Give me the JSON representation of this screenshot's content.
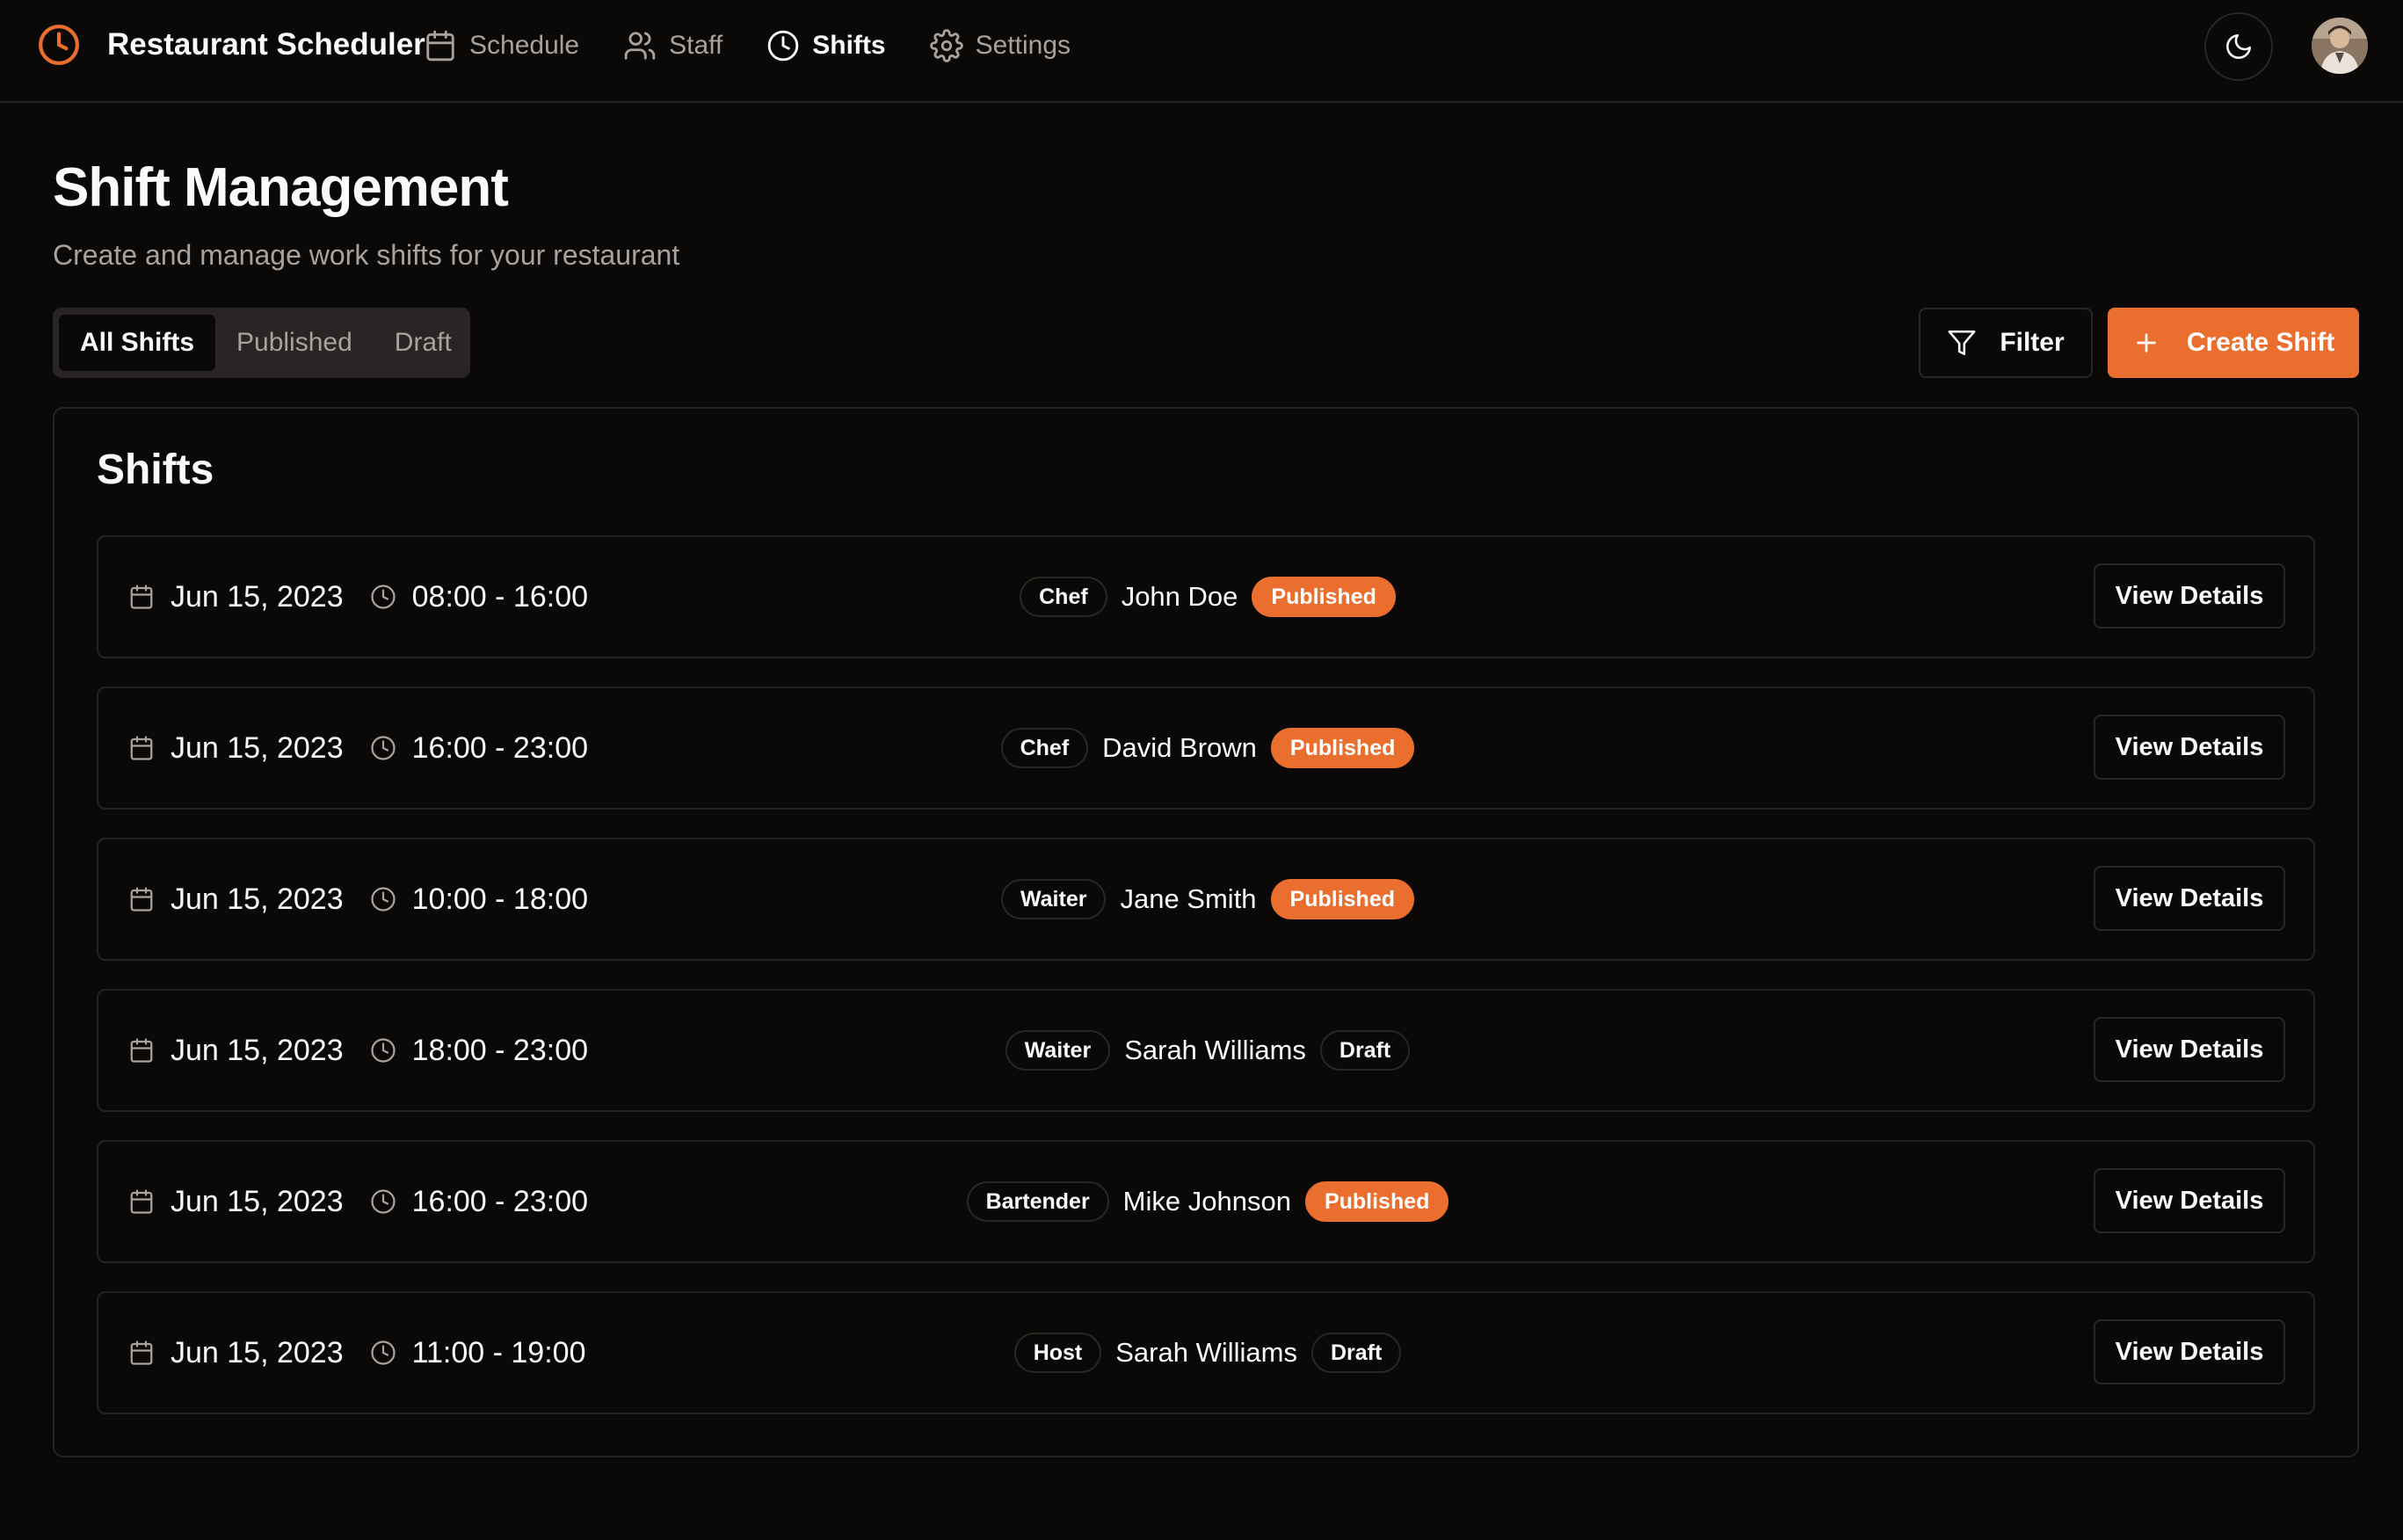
{
  "app": {
    "name": "Restaurant Scheduler",
    "accent_color": "#ea6f2e",
    "logo_icon": "clock-icon"
  },
  "nav": {
    "items": [
      {
        "label": "Schedule",
        "icon": "calendar-icon",
        "active": false
      },
      {
        "label": "Staff",
        "icon": "users-icon",
        "active": false
      },
      {
        "label": "Shifts",
        "icon": "clock-icon",
        "active": true
      },
      {
        "label": "Settings",
        "icon": "gear-icon",
        "active": false
      }
    ],
    "theme_toggle_icon": "moon-icon"
  },
  "page": {
    "title": "Shift Management",
    "subtitle": "Create and manage work shifts for your restaurant"
  },
  "tabs": [
    {
      "label": "All Shifts",
      "active": true
    },
    {
      "label": "Published",
      "active": false
    },
    {
      "label": "Draft",
      "active": false
    }
  ],
  "actions": {
    "filter_label": "Filter",
    "create_label": "Create Shift"
  },
  "shifts_card": {
    "title": "Shifts",
    "view_label": "View Details",
    "rows": [
      {
        "date": "Jun 15, 2023",
        "time": "08:00 - 16:00",
        "role": "Chef",
        "name": "John Doe",
        "status": "Published"
      },
      {
        "date": "Jun 15, 2023",
        "time": "16:00 - 23:00",
        "role": "Chef",
        "name": "David Brown",
        "status": "Published"
      },
      {
        "date": "Jun 15, 2023",
        "time": "10:00 - 18:00",
        "role": "Waiter",
        "name": "Jane Smith",
        "status": "Published"
      },
      {
        "date": "Jun 15, 2023",
        "time": "18:00 - 23:00",
        "role": "Waiter",
        "name": "Sarah Williams",
        "status": "Draft"
      },
      {
        "date": "Jun 15, 2023",
        "time": "16:00 - 23:00",
        "role": "Bartender",
        "name": "Mike Johnson",
        "status": "Published"
      },
      {
        "date": "Jun 15, 2023",
        "time": "11:00 - 19:00",
        "role": "Host",
        "name": "Sarah Williams",
        "status": "Draft"
      }
    ]
  }
}
